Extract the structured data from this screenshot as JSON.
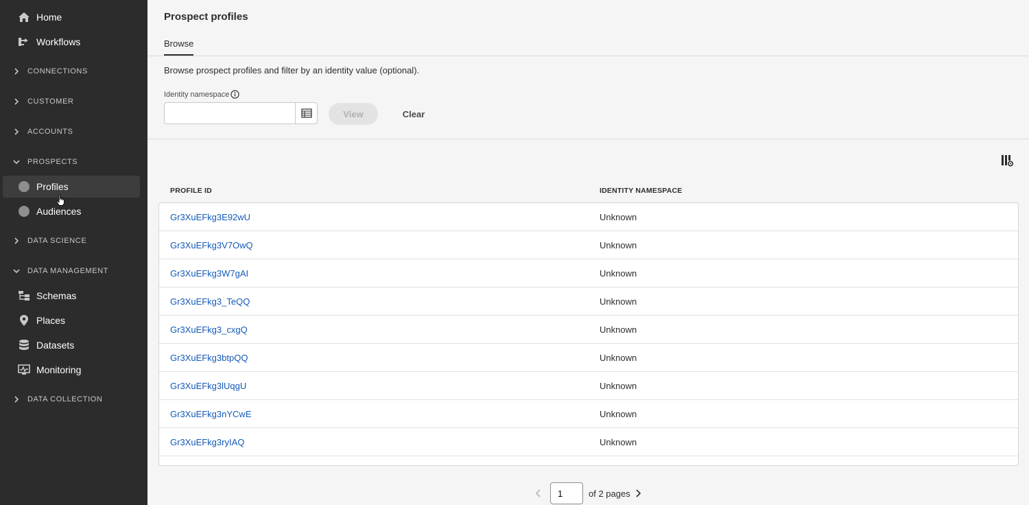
{
  "sidebar": {
    "top_items": [
      {
        "label": "Home",
        "icon": "home-icon"
      },
      {
        "label": "Workflows",
        "icon": "workflow-icon"
      }
    ],
    "sections": {
      "connections": "CONNECTIONS",
      "customer": "CUSTOMER",
      "accounts": "ACCOUNTS",
      "prospects": "PROSPECTS",
      "data_science": "DATA SCIENCE",
      "data_management": "DATA MANAGEMENT",
      "data_collection": "DATA COLLECTION"
    },
    "prospects_items": [
      {
        "label": "Profiles",
        "active": true
      },
      {
        "label": "Audiences",
        "active": false
      }
    ],
    "data_management_items": [
      {
        "label": "Schemas",
        "icon": "schema-icon"
      },
      {
        "label": "Places",
        "icon": "pin-icon"
      },
      {
        "label": "Datasets",
        "icon": "database-icon"
      },
      {
        "label": "Monitoring",
        "icon": "monitor-icon"
      }
    ]
  },
  "main": {
    "title": "Prospect profiles",
    "tab": "Browse",
    "description": "Browse prospect profiles and filter by an identity value (optional).",
    "filter": {
      "label": "Identity namespace",
      "value": "",
      "view_label": "View",
      "clear_label": "Clear"
    },
    "table": {
      "headers": [
        "PROFILE ID",
        "IDENTITY NAMESPACE"
      ],
      "rows": [
        {
          "id": "Gr3XuEFkg3E92wU",
          "namespace": "Unknown"
        },
        {
          "id": "Gr3XuEFkg3V7OwQ",
          "namespace": "Unknown"
        },
        {
          "id": "Gr3XuEFkg3W7gAI",
          "namespace": "Unknown"
        },
        {
          "id": "Gr3XuEFkg3_TeQQ",
          "namespace": "Unknown"
        },
        {
          "id": "Gr3XuEFkg3_cxgQ",
          "namespace": "Unknown"
        },
        {
          "id": "Gr3XuEFkg3btpQQ",
          "namespace": "Unknown"
        },
        {
          "id": "Gr3XuEFkg3lUqgU",
          "namespace": "Unknown"
        },
        {
          "id": "Gr3XuEFkg3nYCwE",
          "namespace": "Unknown"
        },
        {
          "id": "Gr3XuEFkg3ryIAQ",
          "namespace": "Unknown"
        }
      ]
    },
    "pagination": {
      "current": "1",
      "label": "of 2 pages"
    }
  },
  "colors": {
    "sidebar_bg": "#2c2c2c",
    "link": "#1359b8",
    "page_bg": "#f5f5f5"
  }
}
